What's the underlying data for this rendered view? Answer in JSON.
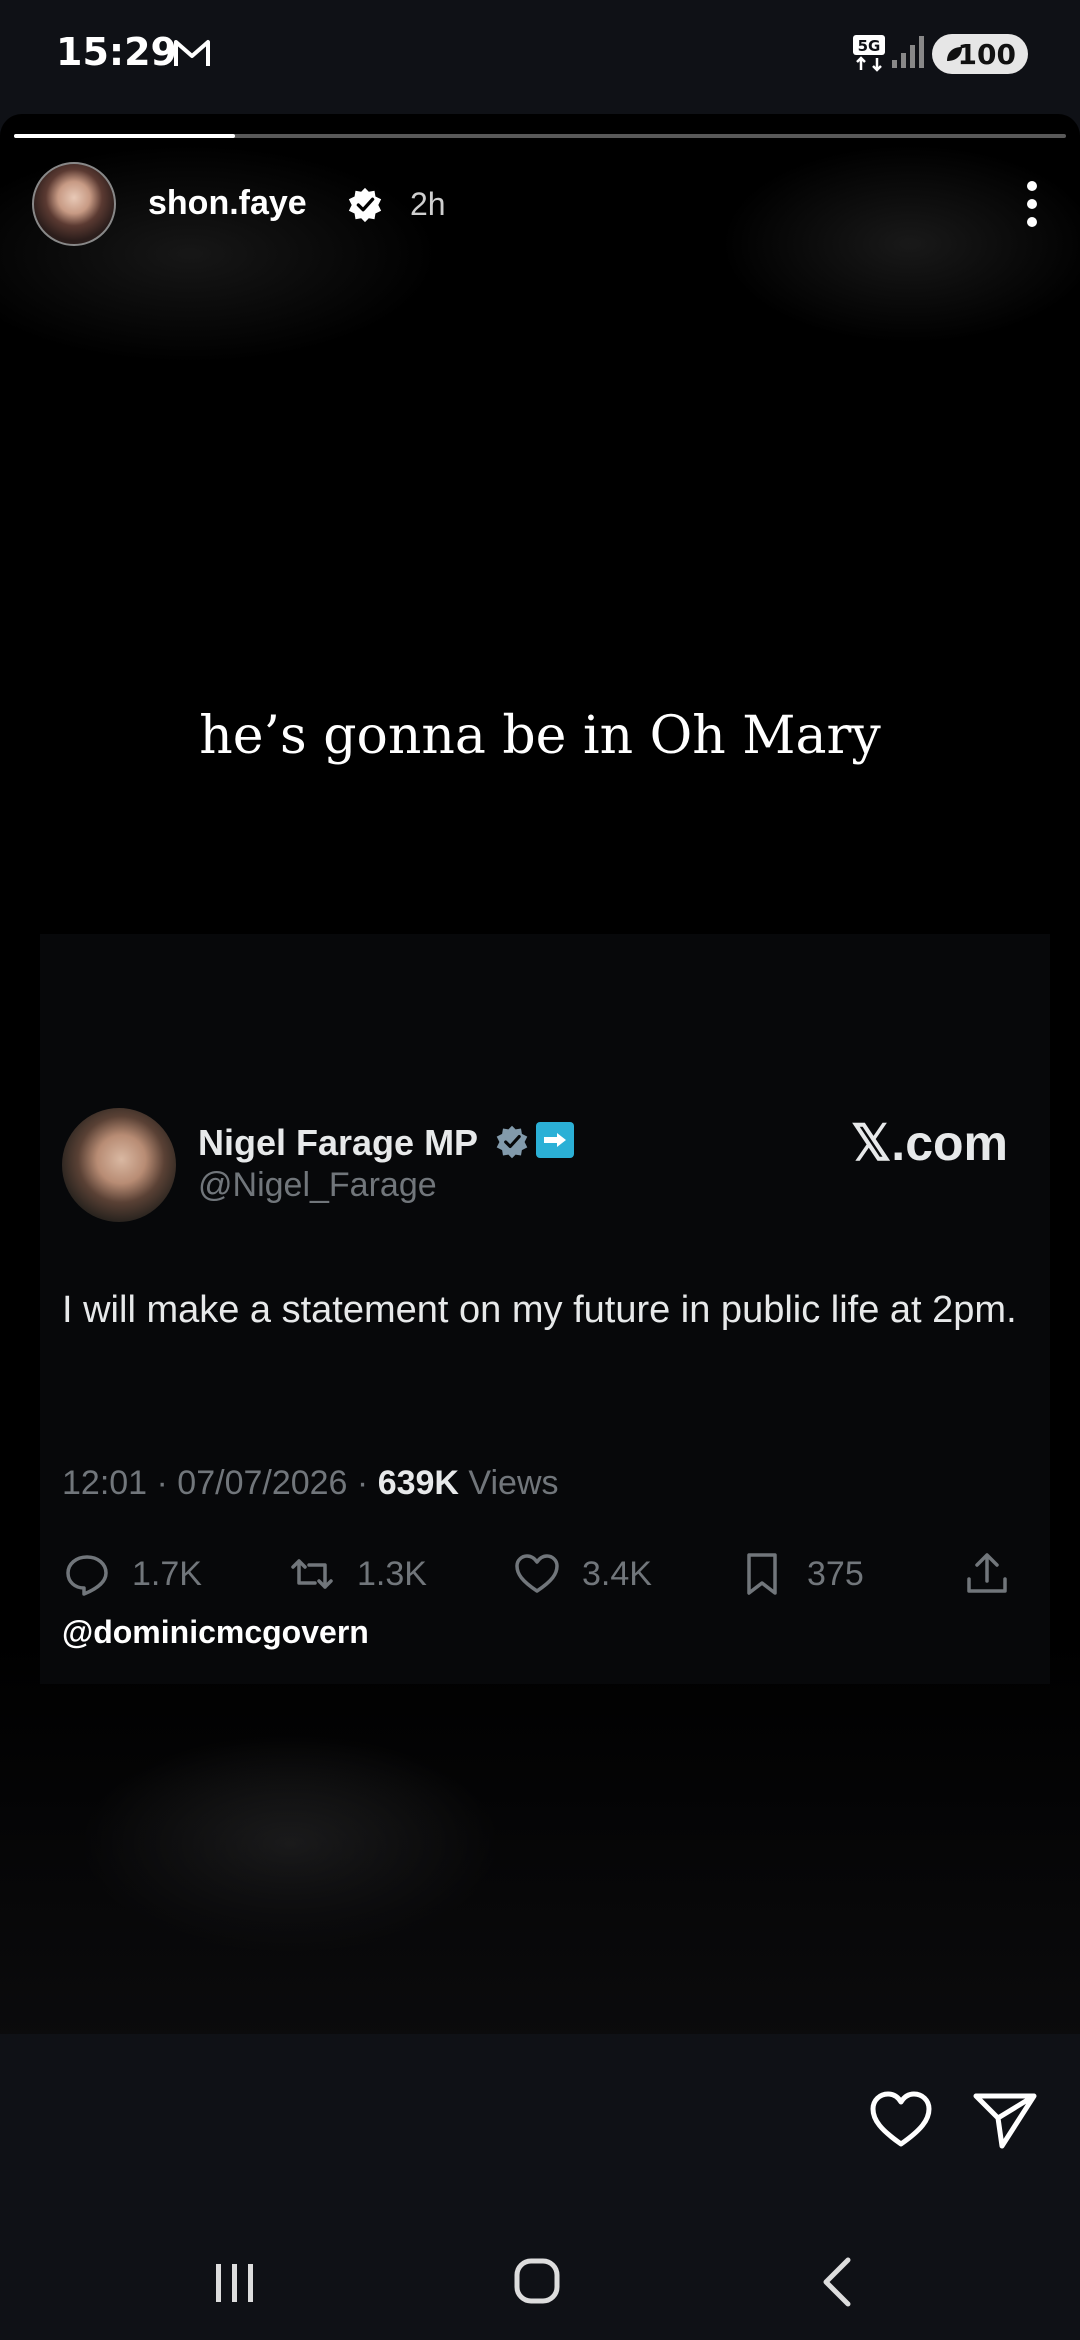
{
  "status_bar": {
    "time": "15:29",
    "network": "5G",
    "battery": "100",
    "icons": [
      "gmail-icon",
      "5g-icon",
      "signal-icon",
      "battery-icon"
    ]
  },
  "story": {
    "progress": 0.21,
    "username": "shon.faye",
    "age": "2h",
    "caption": "he’s gonna be in Oh Mary",
    "credit": "@dominicmcgovern"
  },
  "tweet": {
    "name": "Nigel Farage MP",
    "handle": "@Nigel_Farage",
    "source": "𝕏.com",
    "text": "I will make a statement on my future in public life at 2pm.",
    "timestamp": "12:01 · 07/07/2026 · ",
    "views_count": "639K",
    "views_label": "Views",
    "replies": "1.7K",
    "reposts": "1.3K",
    "likes": "3.4K",
    "bookmarks": "375"
  },
  "colors": {
    "background": "#000000",
    "chrome": "#0f1116",
    "x_secondary": "#71767b",
    "x_primary": "#e7e9ea",
    "reform_badge": "#2bb0d6"
  }
}
